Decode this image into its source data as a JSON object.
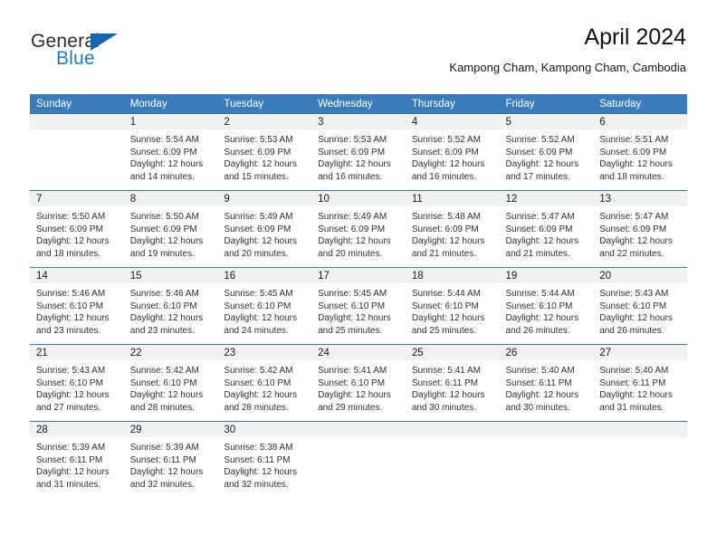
{
  "brand": {
    "name_part1": "General",
    "name_part2": "Blue",
    "accent_color": "#1267b2",
    "blue_text_color": "#1f7bc4"
  },
  "header": {
    "title": "April 2024",
    "subtitle": "Kampong Cham, Kampong Cham, Cambodia"
  },
  "calendar": {
    "header_bg": "#3a7cba",
    "daynum_bg": "#f1f1f1",
    "weekdays": [
      "Sunday",
      "Monday",
      "Tuesday",
      "Wednesday",
      "Thursday",
      "Friday",
      "Saturday"
    ],
    "weeks": [
      [
        {
          "day": "",
          "sunrise": "",
          "sunset": "",
          "daylight1": "",
          "daylight2": ""
        },
        {
          "day": "1",
          "sunrise": "Sunrise: 5:54 AM",
          "sunset": "Sunset: 6:09 PM",
          "daylight1": "Daylight: 12 hours",
          "daylight2": "and 14 minutes."
        },
        {
          "day": "2",
          "sunrise": "Sunrise: 5:53 AM",
          "sunset": "Sunset: 6:09 PM",
          "daylight1": "Daylight: 12 hours",
          "daylight2": "and 15 minutes."
        },
        {
          "day": "3",
          "sunrise": "Sunrise: 5:53 AM",
          "sunset": "Sunset: 6:09 PM",
          "daylight1": "Daylight: 12 hours",
          "daylight2": "and 16 minutes."
        },
        {
          "day": "4",
          "sunrise": "Sunrise: 5:52 AM",
          "sunset": "Sunset: 6:09 PM",
          "daylight1": "Daylight: 12 hours",
          "daylight2": "and 16 minutes."
        },
        {
          "day": "5",
          "sunrise": "Sunrise: 5:52 AM",
          "sunset": "Sunset: 6:09 PM",
          "daylight1": "Daylight: 12 hours",
          "daylight2": "and 17 minutes."
        },
        {
          "day": "6",
          "sunrise": "Sunrise: 5:51 AM",
          "sunset": "Sunset: 6:09 PM",
          "daylight1": "Daylight: 12 hours",
          "daylight2": "and 18 minutes."
        }
      ],
      [
        {
          "day": "7",
          "sunrise": "Sunrise: 5:50 AM",
          "sunset": "Sunset: 6:09 PM",
          "daylight1": "Daylight: 12 hours",
          "daylight2": "and 18 minutes."
        },
        {
          "day": "8",
          "sunrise": "Sunrise: 5:50 AM",
          "sunset": "Sunset: 6:09 PM",
          "daylight1": "Daylight: 12 hours",
          "daylight2": "and 19 minutes."
        },
        {
          "day": "9",
          "sunrise": "Sunrise: 5:49 AM",
          "sunset": "Sunset: 6:09 PM",
          "daylight1": "Daylight: 12 hours",
          "daylight2": "and 20 minutes."
        },
        {
          "day": "10",
          "sunrise": "Sunrise: 5:49 AM",
          "sunset": "Sunset: 6:09 PM",
          "daylight1": "Daylight: 12 hours",
          "daylight2": "and 20 minutes."
        },
        {
          "day": "11",
          "sunrise": "Sunrise: 5:48 AM",
          "sunset": "Sunset: 6:09 PM",
          "daylight1": "Daylight: 12 hours",
          "daylight2": "and 21 minutes."
        },
        {
          "day": "12",
          "sunrise": "Sunrise: 5:47 AM",
          "sunset": "Sunset: 6:09 PM",
          "daylight1": "Daylight: 12 hours",
          "daylight2": "and 21 minutes."
        },
        {
          "day": "13",
          "sunrise": "Sunrise: 5:47 AM",
          "sunset": "Sunset: 6:09 PM",
          "daylight1": "Daylight: 12 hours",
          "daylight2": "and 22 minutes."
        }
      ],
      [
        {
          "day": "14",
          "sunrise": "Sunrise: 5:46 AM",
          "sunset": "Sunset: 6:10 PM",
          "daylight1": "Daylight: 12 hours",
          "daylight2": "and 23 minutes."
        },
        {
          "day": "15",
          "sunrise": "Sunrise: 5:46 AM",
          "sunset": "Sunset: 6:10 PM",
          "daylight1": "Daylight: 12 hours",
          "daylight2": "and 23 minutes."
        },
        {
          "day": "16",
          "sunrise": "Sunrise: 5:45 AM",
          "sunset": "Sunset: 6:10 PM",
          "daylight1": "Daylight: 12 hours",
          "daylight2": "and 24 minutes."
        },
        {
          "day": "17",
          "sunrise": "Sunrise: 5:45 AM",
          "sunset": "Sunset: 6:10 PM",
          "daylight1": "Daylight: 12 hours",
          "daylight2": "and 25 minutes."
        },
        {
          "day": "18",
          "sunrise": "Sunrise: 5:44 AM",
          "sunset": "Sunset: 6:10 PM",
          "daylight1": "Daylight: 12 hours",
          "daylight2": "and 25 minutes."
        },
        {
          "day": "19",
          "sunrise": "Sunrise: 5:44 AM",
          "sunset": "Sunset: 6:10 PM",
          "daylight1": "Daylight: 12 hours",
          "daylight2": "and 26 minutes."
        },
        {
          "day": "20",
          "sunrise": "Sunrise: 5:43 AM",
          "sunset": "Sunset: 6:10 PM",
          "daylight1": "Daylight: 12 hours",
          "daylight2": "and 26 minutes."
        }
      ],
      [
        {
          "day": "21",
          "sunrise": "Sunrise: 5:43 AM",
          "sunset": "Sunset: 6:10 PM",
          "daylight1": "Daylight: 12 hours",
          "daylight2": "and 27 minutes."
        },
        {
          "day": "22",
          "sunrise": "Sunrise: 5:42 AM",
          "sunset": "Sunset: 6:10 PM",
          "daylight1": "Daylight: 12 hours",
          "daylight2": "and 28 minutes."
        },
        {
          "day": "23",
          "sunrise": "Sunrise: 5:42 AM",
          "sunset": "Sunset: 6:10 PM",
          "daylight1": "Daylight: 12 hours",
          "daylight2": "and 28 minutes."
        },
        {
          "day": "24",
          "sunrise": "Sunrise: 5:41 AM",
          "sunset": "Sunset: 6:10 PM",
          "daylight1": "Daylight: 12 hours",
          "daylight2": "and 29 minutes."
        },
        {
          "day": "25",
          "sunrise": "Sunrise: 5:41 AM",
          "sunset": "Sunset: 6:11 PM",
          "daylight1": "Daylight: 12 hours",
          "daylight2": "and 30 minutes."
        },
        {
          "day": "26",
          "sunrise": "Sunrise: 5:40 AM",
          "sunset": "Sunset: 6:11 PM",
          "daylight1": "Daylight: 12 hours",
          "daylight2": "and 30 minutes."
        },
        {
          "day": "27",
          "sunrise": "Sunrise: 5:40 AM",
          "sunset": "Sunset: 6:11 PM",
          "daylight1": "Daylight: 12 hours",
          "daylight2": "and 31 minutes."
        }
      ],
      [
        {
          "day": "28",
          "sunrise": "Sunrise: 5:39 AM",
          "sunset": "Sunset: 6:11 PM",
          "daylight1": "Daylight: 12 hours",
          "daylight2": "and 31 minutes."
        },
        {
          "day": "29",
          "sunrise": "Sunrise: 5:39 AM",
          "sunset": "Sunset: 6:11 PM",
          "daylight1": "Daylight: 12 hours",
          "daylight2": "and 32 minutes."
        },
        {
          "day": "30",
          "sunrise": "Sunrise: 5:38 AM",
          "sunset": "Sunset: 6:11 PM",
          "daylight1": "Daylight: 12 hours",
          "daylight2": "and 32 minutes."
        },
        {
          "day": "",
          "sunrise": "",
          "sunset": "",
          "daylight1": "",
          "daylight2": ""
        },
        {
          "day": "",
          "sunrise": "",
          "sunset": "",
          "daylight1": "",
          "daylight2": ""
        },
        {
          "day": "",
          "sunrise": "",
          "sunset": "",
          "daylight1": "",
          "daylight2": ""
        },
        {
          "day": "",
          "sunrise": "",
          "sunset": "",
          "daylight1": "",
          "daylight2": ""
        }
      ]
    ]
  }
}
